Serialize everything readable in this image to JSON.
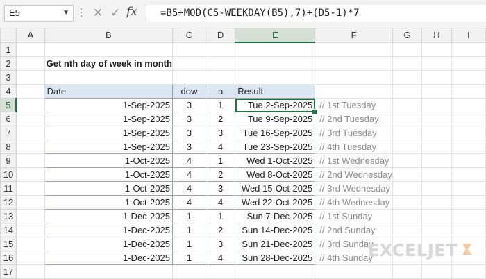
{
  "name_box": "E5",
  "formula_bar": {
    "fx_label": "fx",
    "cancel_icon": "x-icon",
    "enter_icon": "check-icon",
    "formula": "=B5+MOD(C5-WEEKDAY(B5),7)+(D5-1)*7"
  },
  "columns": [
    "A",
    "B",
    "C",
    "D",
    "E",
    "F",
    "G",
    "H",
    "I"
  ],
  "rows": [
    "1",
    "2",
    "3",
    "4",
    "5",
    "6",
    "7",
    "8",
    "9",
    "10",
    "11",
    "12",
    "13",
    "14",
    "15",
    "16",
    "17"
  ],
  "active_cell": {
    "column": "E",
    "row": "5"
  },
  "sheet": {
    "title": "Get nth day of week in month",
    "headers": {
      "date": "Date",
      "dow": "dow",
      "n": "n",
      "result": "Result"
    },
    "data": [
      {
        "date": "1-Sep-2025",
        "dow": "3",
        "n": "1",
        "result": "Tue 2-Sep-2025",
        "comment": "// 1st Tuesday"
      },
      {
        "date": "1-Sep-2025",
        "dow": "3",
        "n": "2",
        "result": "Tue 9-Sep-2025",
        "comment": "// 2nd Tuesday"
      },
      {
        "date": "1-Sep-2025",
        "dow": "3",
        "n": "3",
        "result": "Tue 16-Sep-2025",
        "comment": "// 3rd Tuesday"
      },
      {
        "date": "1-Sep-2025",
        "dow": "3",
        "n": "4",
        "result": "Tue 23-Sep-2025",
        "comment": "// 4th Tuesday"
      },
      {
        "date": "1-Oct-2025",
        "dow": "4",
        "n": "1",
        "result": "Wed 1-Oct-2025",
        "comment": "// 1st Wednesday"
      },
      {
        "date": "1-Oct-2025",
        "dow": "4",
        "n": "2",
        "result": "Wed 8-Oct-2025",
        "comment": "// 2nd Wednesday"
      },
      {
        "date": "1-Oct-2025",
        "dow": "4",
        "n": "3",
        "result": "Wed 15-Oct-2025",
        "comment": "// 3rd Wednesday"
      },
      {
        "date": "1-Oct-2025",
        "dow": "4",
        "n": "4",
        "result": "Wed 22-Oct-2025",
        "comment": "// 4th Wednesday"
      },
      {
        "date": "1-Dec-2025",
        "dow": "1",
        "n": "1",
        "result": "Sun 7-Dec-2025",
        "comment": "// 1st Sunday"
      },
      {
        "date": "1-Dec-2025",
        "dow": "1",
        "n": "2",
        "result": "Sun 14-Dec-2025",
        "comment": "// 2nd Sunday"
      },
      {
        "date": "1-Dec-2025",
        "dow": "1",
        "n": "3",
        "result": "Sun 21-Dec-2025",
        "comment": "// 3rd Sunday"
      },
      {
        "date": "1-Dec-2025",
        "dow": "1",
        "n": "4",
        "result": "Sun 28-Dec-2025",
        "comment": "// 4th Sunday"
      }
    ]
  },
  "logo": "EXCELJET",
  "colors": {
    "selection": "#217346",
    "header_fill": "#dce6f3",
    "comment_text": "#8a8a8a"
  }
}
